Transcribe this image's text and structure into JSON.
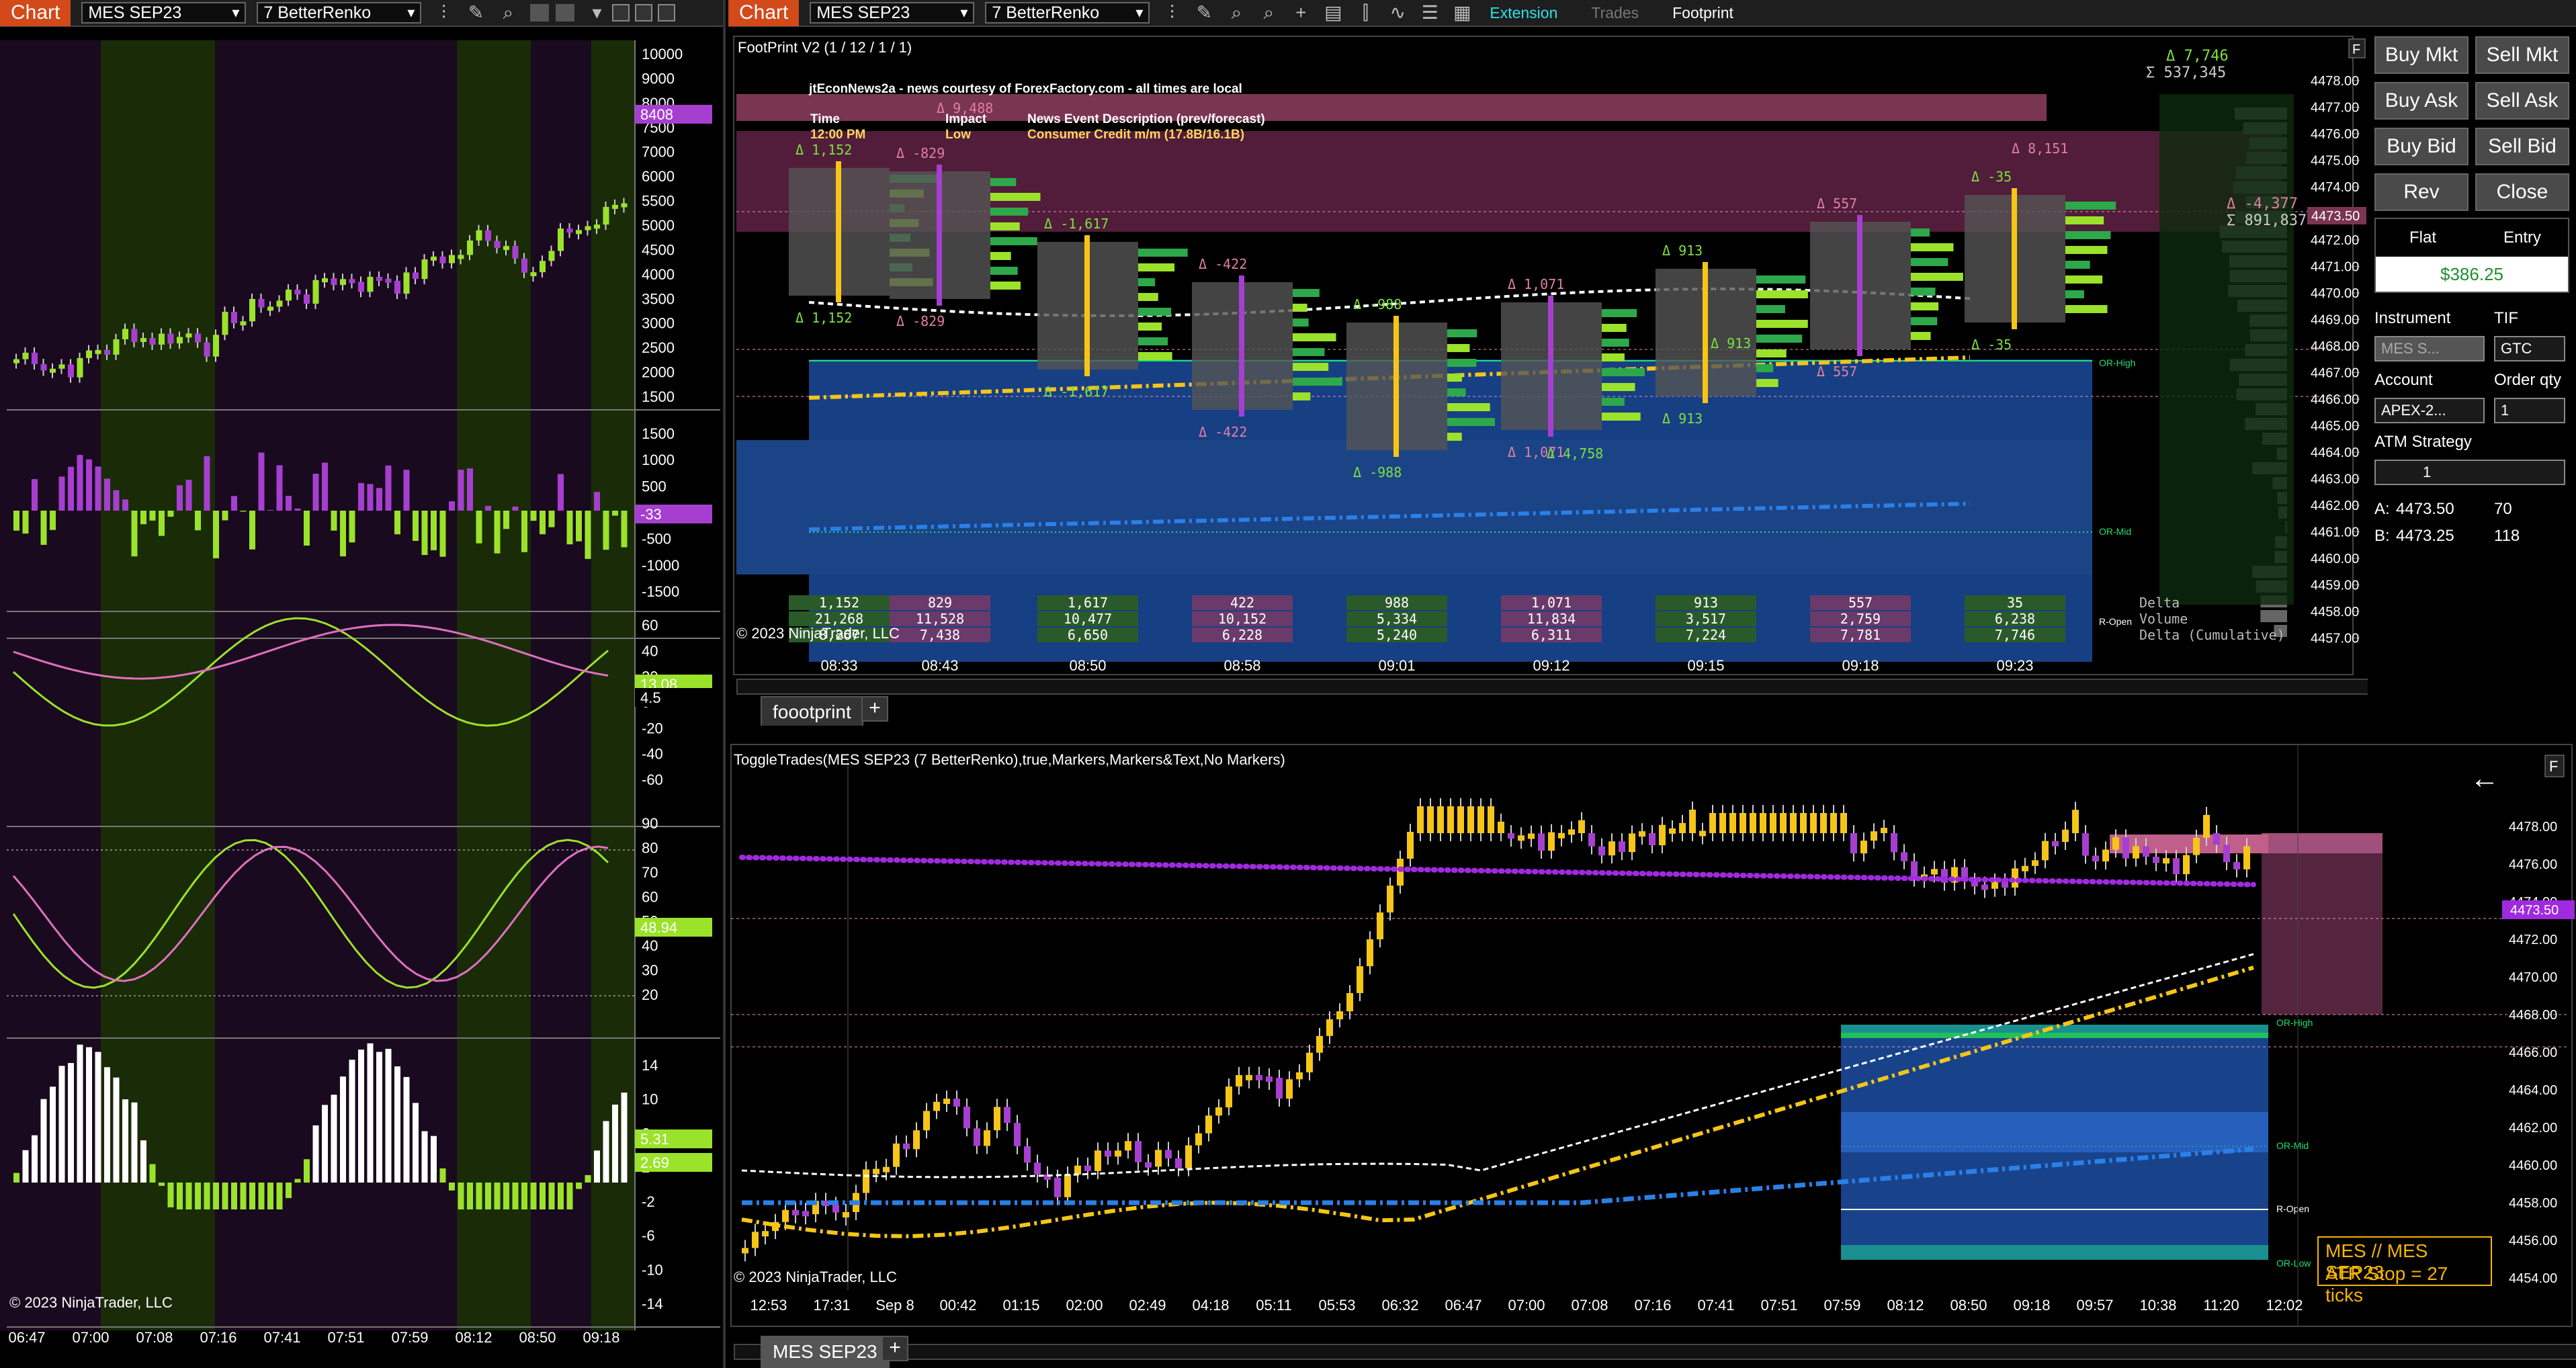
{
  "left": {
    "chart_label": "Chart",
    "instrument": "MES SEP23",
    "bar_type": "7 BetterRenko",
    "copyright": "© 2023 NinjaTrader, LLC",
    "price_axis": [
      "10000",
      "9000",
      "8000",
      "7500",
      "7000",
      "6000",
      "5500",
      "5000",
      "4500",
      "4000",
      "3500",
      "3000",
      "2500",
      "2000",
      "1500"
    ],
    "price_label": "8408",
    "osc1_axis": [
      "1500",
      "1000",
      "500",
      "0",
      "-500",
      "-1000",
      "-1500"
    ],
    "osc1_label": "-33",
    "osc2_axis": [
      "60",
      "40",
      "20",
      "0",
      "-20",
      "-40",
      "-60"
    ],
    "osc2_labels": [
      "13.08",
      "4.5"
    ],
    "osc3_axis": [
      "90",
      "80",
      "70",
      "60",
      "50",
      "40",
      "30",
      "20"
    ],
    "osc3_label": "48.94",
    "osc4_axis": [
      "14",
      "10",
      "6",
      "2",
      "-2",
      "-6",
      "-10",
      "-14"
    ],
    "osc4_labels": [
      "5.31",
      "2.69"
    ],
    "times": [
      "06:47",
      "07:00",
      "07:08",
      "07:16",
      "07:41",
      "07:51",
      "07:59",
      "08:12",
      "08:50",
      "09:18"
    ]
  },
  "top": {
    "chart_label": "Chart",
    "instrument": "MES SEP23",
    "bar_type": "7 BetterRenko",
    "extension": "Extension",
    "trades": "Trades",
    "footprint": "Footprint",
    "indicator_title": "FootPrint V2 (1 / 12 / 1 / 1)",
    "news_title": "jtEconNews2a - news courtesy of ForexFactory.com - all times are local",
    "news_hdr_time": "Time",
    "news_hdr_impact": "Impact",
    "news_hdr_desc": "News Event Description (prev/forecast)",
    "news_time": "12:00 PM",
    "news_impact": "Low",
    "news_desc": "Consumer Credit m/m (17.8B/16.1B)",
    "copyright": "© 2023 NinjaTrader, LLC",
    "price_axis": [
      "4478.00",
      "4477.00",
      "4476.00",
      "4475.00",
      "4474.00",
      "4473.00",
      "4472.00",
      "4471.00",
      "4470.00",
      "4469.00",
      "4468.00",
      "4467.00",
      "4466.00",
      "4465.00",
      "4464.00",
      "4463.00",
      "4462.00",
      "4461.00",
      "4460.00",
      "4459.00",
      "4458.00",
      "4457.00"
    ],
    "price_label": "4473.50",
    "times": [
      "08:33",
      "08:43",
      "08:50",
      "08:58",
      "09:01",
      "09:12",
      "09:15",
      "09:18",
      "09:23"
    ],
    "deltas_top": [
      "Δ 1,152",
      "Δ -829",
      "Δ -1,617",
      "Δ -422",
      "Δ -988",
      "Δ 1,071",
      "Δ 913",
      "Δ 557",
      "Δ -35"
    ],
    "deltas_bot": [
      "Δ 1,152",
      "Δ -829",
      "Δ -1,617",
      "Δ -422",
      "Δ -988",
      "Δ 1,071",
      "Δ 913",
      "Δ 557",
      "Δ -35"
    ],
    "extra_labels": [
      "Δ 9,488",
      "Δ 8,151",
      "Δ 4,758",
      "Δ 913"
    ],
    "right_delta": "Δ 7,746",
    "right_sigma": "Σ 537,345",
    "right_delta2": "Δ -4,377",
    "right_sigma2": "Σ 891,837",
    "row_delta": [
      "1,152",
      "829",
      "1,617",
      "422",
      "988",
      "1,071",
      "913",
      "557",
      "35"
    ],
    "row_volume": [
      "21,268",
      "11,528",
      "10,477",
      "10,152",
      "5,334",
      "11,834",
      "3,517",
      "2,759",
      "6,238"
    ],
    "row_cum": [
      "8,267",
      "7,438",
      "6,650",
      "6,228",
      "5,240",
      "6,311",
      "7,224",
      "7,781",
      "7,746"
    ],
    "row_names": [
      "Delta",
      "Volume",
      "Delta (Cumulative)"
    ],
    "or_high": "OR-High",
    "or_mid": "OR-Mid",
    "r_open": "R-Open",
    "tab": "foootprint"
  },
  "bottom": {
    "title": "ToggleTrades(MES SEP23 (7 BetterRenko),true,Markers,Markers&Text,No Markers)",
    "copyright": "© 2023 NinjaTrader, LLC",
    "price_axis": [
      "4478.00",
      "4476.00",
      "4474.00",
      "4472.00",
      "4470.00",
      "4468.00",
      "4466.00",
      "4464.00",
      "4462.00",
      "4460.00",
      "4458.00",
      "4456.00",
      "4454.00"
    ],
    "price_label": "4473.50",
    "times": [
      "12:53",
      "17:31",
      "Sep 8",
      "00:42",
      "01:15",
      "02:00",
      "02:49",
      "04:18",
      "05:11",
      "05:53",
      "06:32",
      "06:47",
      "07:00",
      "07:08",
      "07:16",
      "07:41",
      "07:51",
      "07:59",
      "08:12",
      "08:50",
      "09:18",
      "09:57",
      "10:38",
      "11:20",
      "12:02"
    ],
    "or_high": "OR-High",
    "or_mid": "OR-Mid",
    "r_open": "R-Open",
    "or_low": "OR-Low",
    "info1": "MES // MES SEP23",
    "info2": "ATR Stop = 27 ticks",
    "tab": "MES SEP23"
  },
  "trade": {
    "buy_mkt": "Buy Mkt",
    "sell_mkt": "Sell Mkt",
    "buy_ask": "Buy Ask",
    "sell_ask": "Sell Ask",
    "buy_bid": "Buy Bid",
    "sell_bid": "Sell Bid",
    "rev": "Rev",
    "close": "Close",
    "flat": "Flat",
    "entry": "Entry",
    "pnl": "$386.25",
    "instrument_lbl": "Instrument",
    "tif_lbl": "TIF",
    "instrument_val": "MES S...",
    "tif_val": "GTC",
    "account_lbl": "Account",
    "qty_lbl": "Order qty",
    "account_val": "APEX-2...",
    "qty_val": "1",
    "atm_lbl": "ATM Strategy",
    "atm_val": "1",
    "ask_lbl": "A:",
    "ask_price": "4473.50",
    "ask_size": "70",
    "bid_lbl": "B:",
    "bid_price": "4473.25",
    "bid_size": "118"
  },
  "colors": {
    "accent": "#d2491a",
    "bull": "#9be22a",
    "bear": "#a63fd0",
    "gold": "#f5c518",
    "blue": "#2a80e8"
  }
}
